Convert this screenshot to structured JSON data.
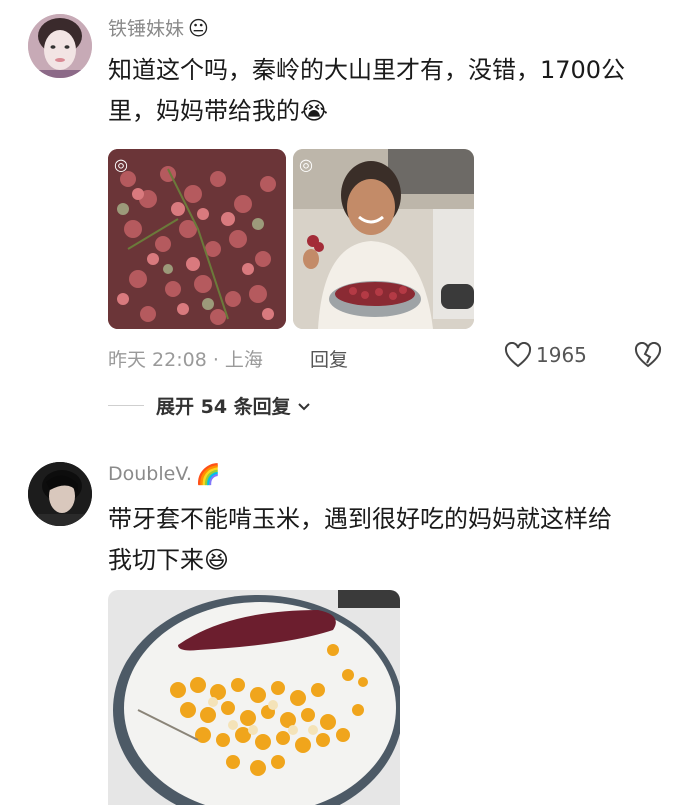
{
  "comments": [
    {
      "username": "铁锤妹妹",
      "username_emoji": "😐",
      "text_line1": "知道这个吗，秦岭的大山里才有，没错，1700公",
      "text_line2": "里，妈妈带给我的",
      "text_emoji": "😭",
      "time": "昨天 22:08 · 上海",
      "reply_label": "回复",
      "likes": "1965",
      "expand_label": "展开 54 条回复"
    },
    {
      "username": "DoubleV.",
      "username_emoji": "🌈",
      "text_line1": "带牙套不能啃玉米，遇到很好吃的妈妈就这样给",
      "text_line2": "我切下来",
      "text_emoji": "😆"
    }
  ],
  "icons": {
    "like": "heart-icon",
    "dislike": "broken-heart-icon",
    "expand": "chevron-down-icon",
    "live_photo": "live-photo-icon"
  }
}
